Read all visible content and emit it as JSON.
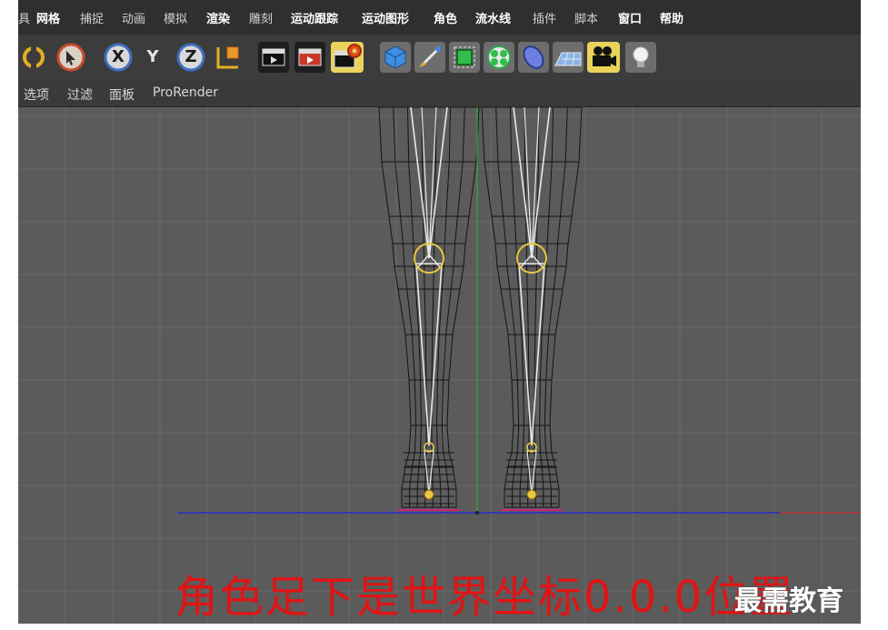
{
  "menubar": {
    "items": [
      {
        "label": "具",
        "highlight": false
      },
      {
        "label": "网格",
        "highlight": true
      },
      {
        "label": "捕捉",
        "highlight": false
      },
      {
        "label": "动画",
        "highlight": false
      },
      {
        "label": "模拟",
        "highlight": false
      },
      {
        "label": "渲染",
        "highlight": true
      },
      {
        "label": "雕刻",
        "highlight": false
      },
      {
        "label": "运动跟踪",
        "highlight": true
      },
      {
        "label": "运动图形",
        "highlight": true
      },
      {
        "label": "角色",
        "highlight": true
      },
      {
        "label": "流水线",
        "highlight": true
      },
      {
        "label": "插件",
        "highlight": false
      },
      {
        "label": "脚本",
        "highlight": false
      },
      {
        "label": "窗口",
        "highlight": true
      },
      {
        "label": "帮助",
        "highlight": true
      }
    ]
  },
  "toolbar": {
    "axis_x": "X",
    "axis_y": "Y",
    "axis_z": "Z",
    "tools": [
      "rotate-icon",
      "select-icon",
      "axis-x-icon",
      "axis-y-icon",
      "axis-z-icon",
      "coordinate-system-icon",
      "render-view-icon",
      "render-picture-viewer-icon",
      "render-settings-icon",
      "cube-icon",
      "pen-icon",
      "subdivision-icon",
      "cloner-icon",
      "deformer-icon",
      "floor-icon",
      "camera-icon",
      "light-icon"
    ]
  },
  "viewmenu": {
    "items": [
      "选项",
      "过滤",
      "面板",
      "ProRender"
    ]
  },
  "viewport": {
    "caption": "角色足下是世界坐标0.0.0位置"
  },
  "watermark": "最需教育",
  "colors": {
    "y_axis": "#2fae2f",
    "x_axis": "#2a2ad0",
    "x_axis_pos": "#d02a2a",
    "joint": "#e8c840",
    "bone": "#e8e8e8",
    "caption": "#e01414"
  }
}
